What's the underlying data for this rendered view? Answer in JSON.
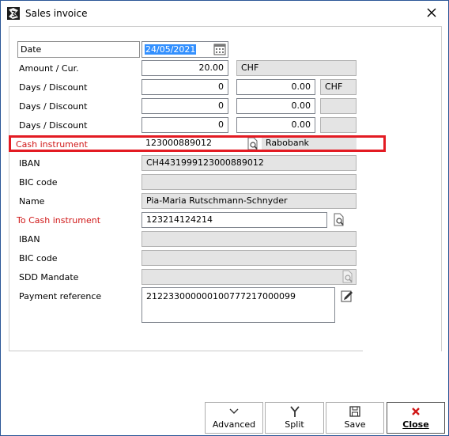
{
  "window": {
    "title": "Sales invoice"
  },
  "icons": {
    "app": "app-icon",
    "close": "close-icon",
    "calendar": "calendar-icon",
    "lookup": "lookup-icon",
    "edit": "edit-note-icon"
  },
  "form": {
    "date": {
      "label": "Date",
      "value": "24/05/2021"
    },
    "amount": {
      "label": "Amount / Cur.",
      "value": "20.00",
      "currency": "CHF"
    },
    "days_discount": [
      {
        "label": "Days / Discount",
        "days": "0",
        "discount": "0.00",
        "currency": "CHF"
      },
      {
        "label": "Days / Discount",
        "days": "0",
        "discount": "0.00",
        "currency": ""
      },
      {
        "label": "Days / Discount",
        "days": "0",
        "discount": "0.00",
        "currency": ""
      }
    ],
    "cash_instrument": {
      "label": "Cash instrument",
      "value": "123000889012",
      "bank": "Rabobank"
    },
    "iban": {
      "label": "IBAN",
      "value": "CH4431999123000889012"
    },
    "bic": {
      "label": "BIC code",
      "value": ""
    },
    "name": {
      "label": "Name",
      "value": "Pia-Maria Rutschmann-Schnyder"
    },
    "to_cash_instrument": {
      "label": "To Cash instrument",
      "value": "123214124214"
    },
    "to_iban": {
      "label": "IBAN",
      "value": ""
    },
    "to_bic": {
      "label": "BIC code",
      "value": ""
    },
    "sdd_mandate": {
      "label": "SDD Mandate",
      "value": ""
    },
    "payment_reference": {
      "label": "Payment reference",
      "value": "212233000000100777217000099"
    }
  },
  "buttons": {
    "advanced": "Advanced",
    "split": "Split",
    "save": "Save",
    "close": "Close"
  },
  "colors": {
    "required_label": "#d01818",
    "highlight": "#e31b23",
    "selection": "#3390ff",
    "readonly": "#e4e4e4"
  }
}
